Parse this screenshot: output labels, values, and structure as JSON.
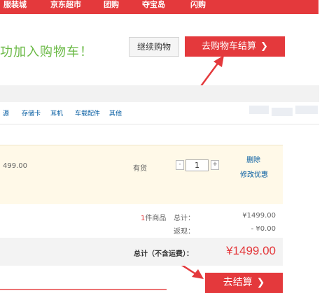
{
  "nav": {
    "items": [
      "服装城",
      "京东超市",
      "团购",
      "夺宝岛",
      "闪购"
    ]
  },
  "success": {
    "message": "功加入购物车！"
  },
  "buttons": {
    "continue_label": "继续购物",
    "go_cart_label": "去购物车结算",
    "checkout_label": "去结算",
    "chevron": "❯"
  },
  "categories": [
    "源",
    "存储卡",
    "耳机",
    "车载配件",
    "其他"
  ],
  "item": {
    "price": "499.00",
    "stock": "有货",
    "qty_minus": "-",
    "qty": "1",
    "qty_plus": "+",
    "delete": "删除",
    "promo": "修改优惠"
  },
  "summary": {
    "count_num": "1",
    "count_suffix": "件商品",
    "total_label": "总计：",
    "total_value": "¥1499.00",
    "rebate_label": "返现：",
    "rebate_value": "- ¥0.00"
  },
  "grand": {
    "label": "总计（不含运费）：",
    "value": "¥1499.00"
  },
  "colors": {
    "brand_red": "#e4393c",
    "success_green": "#6ab945",
    "link_blue": "#005aa0"
  }
}
